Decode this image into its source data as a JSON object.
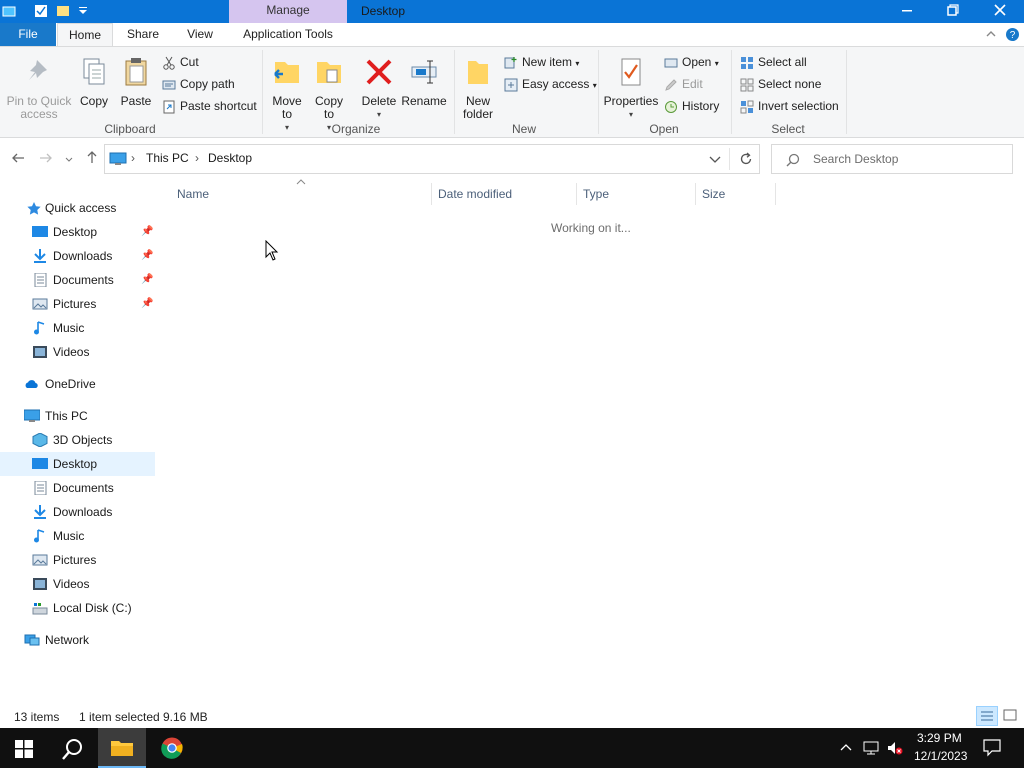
{
  "title_bar": {
    "context_tab": "Manage",
    "title": "Desktop",
    "minimize_icon": "minimize-icon",
    "maximize_icon": "restore-icon",
    "close_icon": "close-icon"
  },
  "ribbon_tabs": {
    "file": "File",
    "home": "Home",
    "share": "Share",
    "view": "View",
    "app_tools": "Application Tools"
  },
  "ribbon": {
    "clipboard": {
      "label": "Clipboard",
      "pin": "Pin to Quick access",
      "copy": "Copy",
      "paste": "Paste",
      "cut": "Cut",
      "copy_path": "Copy path",
      "paste_shortcut": "Paste shortcut"
    },
    "organize": {
      "label": "Organize",
      "move_to": "Move to",
      "copy_to": "Copy to",
      "delete": "Delete",
      "rename": "Rename"
    },
    "new": {
      "label": "New",
      "new_folder": "New folder",
      "new_item": "New item",
      "easy_access": "Easy access"
    },
    "open": {
      "label": "Open",
      "properties": "Properties",
      "open": "Open",
      "edit": "Edit",
      "history": "History"
    },
    "select": {
      "label": "Select",
      "select_all": "Select all",
      "select_none": "Select none",
      "invert": "Invert selection"
    }
  },
  "address_bar": {
    "crumb_1": "This PC",
    "crumb_2": "Desktop",
    "search_placeholder": "Search Desktop"
  },
  "nav_pane": {
    "quick_access": "Quick access",
    "qa_items": [
      "Desktop",
      "Downloads",
      "Documents",
      "Pictures",
      "Music",
      "Videos"
    ],
    "onedrive": "OneDrive",
    "this_pc": "This PC",
    "pc_items": [
      "3D Objects",
      "Desktop",
      "Documents",
      "Downloads",
      "Music",
      "Pictures",
      "Videos",
      "Local Disk (C:)"
    ],
    "network": "Network"
  },
  "columns": {
    "name": "Name",
    "date_modified": "Date modified",
    "type": "Type",
    "size": "Size"
  },
  "content": {
    "status": "Working on it..."
  },
  "status_bar": {
    "items": "13 items",
    "selected": "1 item selected",
    "size": "9.16 MB"
  },
  "taskbar": {
    "time": "3:29 PM",
    "date": "12/1/2023"
  },
  "colors": {
    "title_blue": "#0a74d6",
    "manage_purple": "#d5c5ef",
    "file_tab_blue": "#1979ca",
    "selection": "#e5f3ff",
    "taskbar": "#101010"
  }
}
